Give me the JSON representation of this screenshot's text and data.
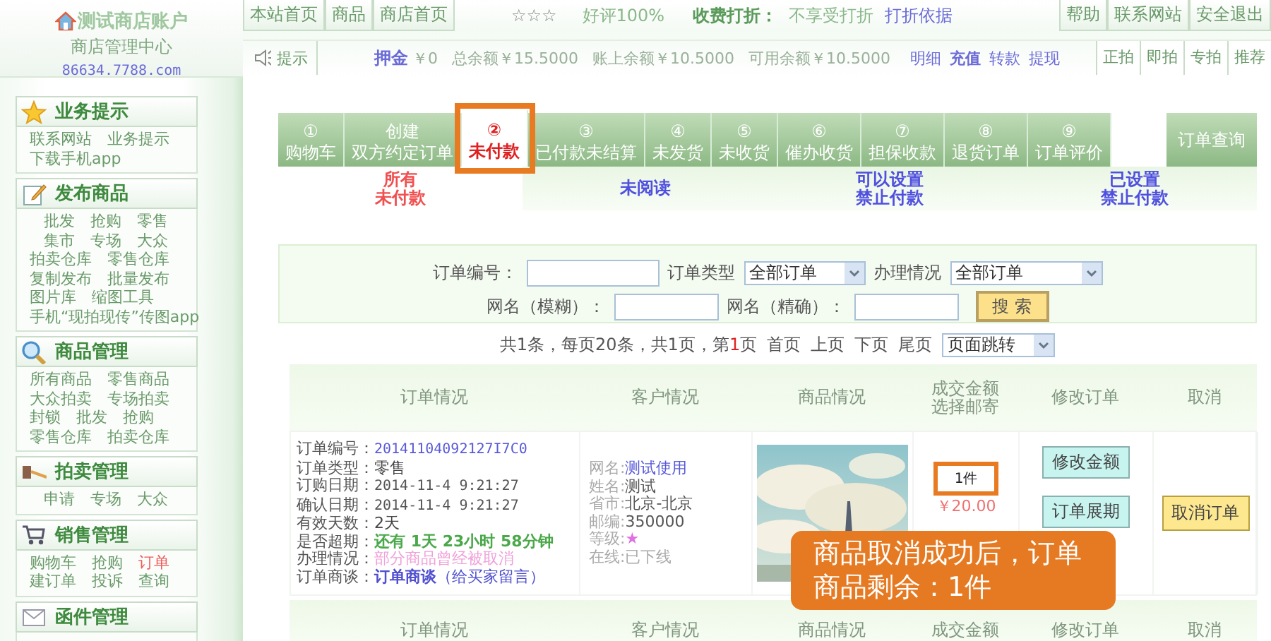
{
  "logo": {
    "title": "测试商店账户",
    "subtitle": "商店管理中心",
    "url": "86634.7788.com"
  },
  "header": {
    "nav_left": [
      "本站首页",
      "商品",
      "商店首页"
    ],
    "stars": "☆☆☆",
    "rating": "好评100%",
    "discount_label": "收费打折：",
    "discount_value": "不享受打折",
    "discount_link": "打折依据",
    "nav_right": [
      "帮助",
      "联系网站",
      "安全退出"
    ]
  },
  "info_bar": {
    "tip": "提示",
    "deposit_label": "押金",
    "deposit_value": "￥0",
    "balances": [
      "总余额￥15.5000",
      "账上余额￥10.5000",
      "可用余额￥10.5000"
    ],
    "links": [
      {
        "label": "明细",
        "bold": false
      },
      {
        "label": "充值",
        "bold": true
      },
      {
        "label": "转款",
        "bold": false
      },
      {
        "label": "提现",
        "bold": false
      }
    ],
    "right_buttons": [
      "正拍",
      "即拍",
      "专拍",
      "推荐"
    ]
  },
  "sidebar": {
    "sections": [
      {
        "title": "业务提示",
        "rows": [
          [
            {
              "label": "联系网站",
              "selected": false
            },
            {
              "label": "业务提示",
              "selected": false
            }
          ],
          [
            {
              "label": "下载手机app",
              "selected": false
            }
          ]
        ]
      },
      {
        "title": "发布商品",
        "rows": [
          [
            {
              "label": "批发",
              "selected": false
            },
            {
              "label": "抢购",
              "selected": false
            },
            {
              "label": "零售",
              "selected": false
            }
          ],
          [
            {
              "label": "集市",
              "selected": false
            },
            {
              "label": "专场",
              "selected": false
            },
            {
              "label": "大众",
              "selected": false
            }
          ],
          [
            {
              "label": "拍卖仓库",
              "selected": false
            },
            {
              "label": "零售仓库",
              "selected": false
            }
          ],
          [
            {
              "label": "复制发布",
              "selected": false
            },
            {
              "label": "批量发布",
              "selected": false
            }
          ],
          [
            {
              "label": "图片库",
              "selected": false
            },
            {
              "label": "缩图工具",
              "selected": false
            }
          ],
          [
            {
              "label": "手机“现拍现传”传图app",
              "selected": false
            }
          ]
        ]
      },
      {
        "title": "商品管理",
        "rows": [
          [
            {
              "label": "所有商品",
              "selected": false
            },
            {
              "label": "零售商品",
              "selected": false
            }
          ],
          [
            {
              "label": "大众拍卖",
              "selected": false
            },
            {
              "label": "专场拍卖",
              "selected": false
            }
          ],
          [
            {
              "label": "封锁",
              "selected": false
            },
            {
              "label": "批发",
              "selected": false
            },
            {
              "label": "抢购",
              "selected": false
            }
          ],
          [
            {
              "label": "零售仓库",
              "selected": false
            },
            {
              "label": "拍卖仓库",
              "selected": false
            }
          ]
        ]
      },
      {
        "title": "拍卖管理",
        "rows": [
          [
            {
              "label": "申请",
              "selected": false
            },
            {
              "label": "专场",
              "selected": false
            },
            {
              "label": "大众",
              "selected": false
            }
          ]
        ]
      },
      {
        "title": "销售管理",
        "rows": [
          [
            {
              "label": "购物车",
              "selected": false
            },
            {
              "label": "抢购",
              "selected": false
            },
            {
              "label": "订单",
              "selected": true
            }
          ],
          [
            {
              "label": "建订单",
              "selected": false
            },
            {
              "label": "投诉",
              "selected": false
            },
            {
              "label": "查询",
              "selected": false
            }
          ]
        ]
      },
      {
        "title": "函件管理"
      }
    ]
  },
  "tabs": [
    {
      "number": "①",
      "label": "购物车",
      "selected": false
    },
    {
      "number": "创建",
      "label": "双方约定订单",
      "selected": false
    },
    {
      "number": "②",
      "label": "未付款",
      "selected": true
    },
    {
      "number": "③",
      "label": "已付款未结算",
      "selected": false
    },
    {
      "number": "④",
      "label": "未发货",
      "selected": false
    },
    {
      "number": "⑤",
      "label": "未收货",
      "selected": false
    },
    {
      "number": "⑥",
      "label": "催办收货",
      "selected": false
    },
    {
      "number": "⑦",
      "label": "担保收款",
      "selected": false
    },
    {
      "number": "⑧",
      "label": "退货订单",
      "selected": false
    },
    {
      "number": "⑨",
      "label": "订单评价",
      "selected": false
    }
  ],
  "query_button": "订单查询",
  "subtabs": [
    {
      "lines": [
        "所有",
        "未付款"
      ],
      "selected": true
    },
    {
      "lines": [
        "未阅读"
      ],
      "selected": false
    },
    {
      "lines": [
        "可以设置",
        "禁止付款"
      ],
      "selected": false
    },
    {
      "lines": [
        "已设置",
        "禁止付款"
      ],
      "selected": false
    }
  ],
  "search": {
    "order_no_label": "订单编号：",
    "order_type_label": "订单类型",
    "order_type_value": "全部订单",
    "status_label": "办理情况",
    "status_value": "全部订单",
    "fuzzy_label": "网名（模糊）：",
    "exact_label": "网名（精确）：",
    "button": "搜 索"
  },
  "pagination": {
    "summary_before": "共1条，每页20条，共1页，第",
    "current_page": "1",
    "summary_after": "页",
    "links": [
      "首页",
      "上页",
      "下页",
      "尾页"
    ],
    "jump": "页面跳转"
  },
  "table": {
    "columns": [
      [
        "订单情况"
      ],
      [
        "客户情况"
      ],
      [
        "商品情况"
      ],
      [
        "成交金额",
        "选择邮寄"
      ],
      [
        "修改订单"
      ],
      [
        "取消"
      ]
    ],
    "rows": [
      {
        "order_info": [
          {
            "label": "订单编号：",
            "value": "20141104092127I7C0",
            "kind": "link"
          },
          {
            "label": "订单类型：",
            "value": "零售",
            "kind": "plain"
          },
          {
            "label": "订购日期：",
            "value": "2014-11-4 9:21:27",
            "kind": "date"
          },
          {
            "label": "确认日期：",
            "value": "2014-11-4 9:21:27",
            "kind": "date"
          },
          {
            "label": "有效天数：",
            "value": "2天",
            "kind": "plain"
          },
          {
            "label": "是否超期：",
            "value": "还有 1天 23小时 58分钟",
            "kind": "countdown"
          },
          {
            "label": "办理情况：",
            "value": "部分商品曾经被取消",
            "kind": "notice"
          },
          {
            "label": "订单商谈：",
            "value": "**订单商谈**（给买家留言）",
            "kind": "chat"
          }
        ],
        "customer": [
          {
            "label": "网名:",
            "value": "测试使用",
            "kind": "link"
          },
          {
            "label": "姓名:",
            "value": "测试",
            "kind": "plain"
          },
          {
            "label": "省市:",
            "value": "北京-北京",
            "kind": "plain"
          },
          {
            "label": "邮编:",
            "value": "350000",
            "kind": "plain"
          },
          {
            "label": "等级:",
            "value": "★",
            "kind": "star"
          },
          {
            "label": "在线:",
            "value": "已下线",
            "kind": "status"
          }
        ],
        "quantity": "1件",
        "price": "￥20.00",
        "modify_buttons": [
          "修改金额",
          "订单展期"
        ],
        "cancel_button": "取消订单"
      }
    ],
    "footer_columns": [
      [
        "订单情况"
      ],
      [
        "客户情况"
      ],
      [
        "商品情况"
      ],
      [
        "成交金额"
      ],
      [
        "修改订单"
      ],
      [
        "取消"
      ]
    ]
  },
  "callout": "商品取消成功后，订单商品剩余：1件"
}
